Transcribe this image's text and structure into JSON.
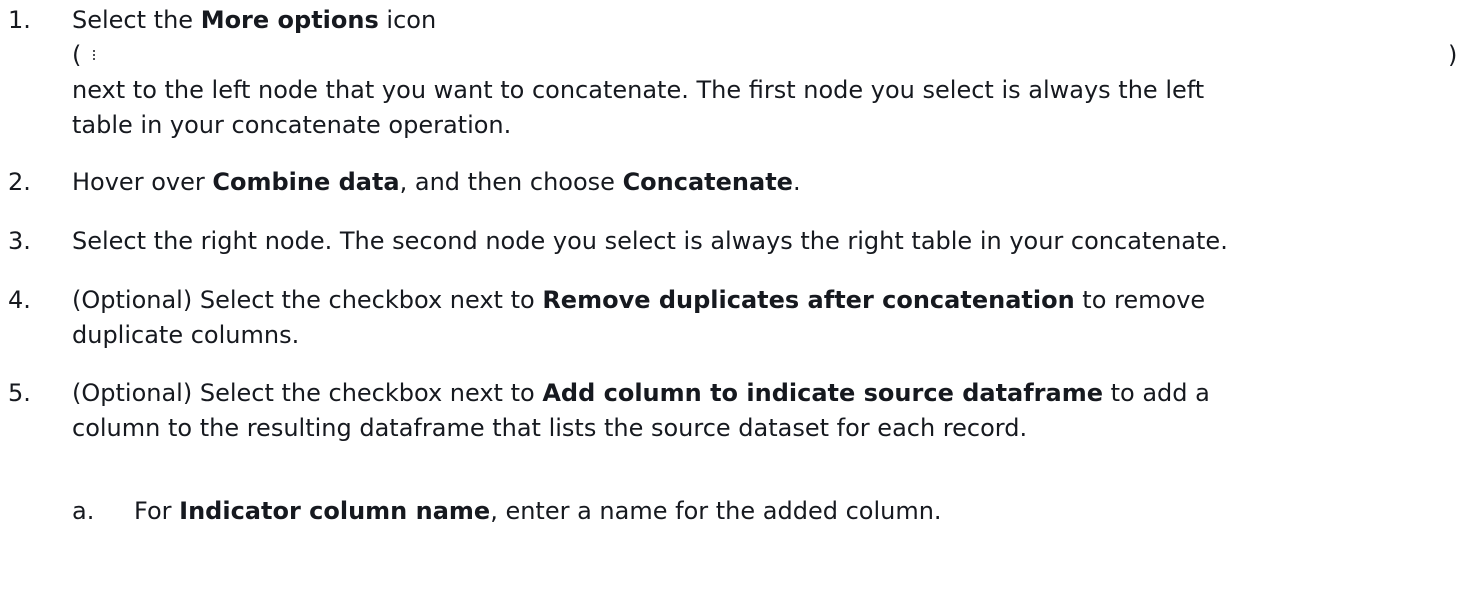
{
  "steps": [
    {
      "number": "1.",
      "pre": "Select the ",
      "bold": "More options",
      "post": " icon",
      "paren_open": "(",
      "paren_close": ")",
      "line3": "next to the left node that you want to concatenate. The first node you select is always the left",
      "line4": "table in your concatenate operation."
    },
    {
      "number": "2.",
      "pre": "Hover over ",
      "bold1": "Combine data",
      "mid": ", and then choose ",
      "bold2": "Concatenate",
      "post": "."
    },
    {
      "number": "3.",
      "text": "Select the right node. The second node you select is always the right table in your concatenate."
    },
    {
      "number": "4.",
      "pre": "(Optional) Select the checkbox next to ",
      "bold": "Remove duplicates after concatenation",
      "post": " to remove",
      "line2": "duplicate columns."
    },
    {
      "number": "5.",
      "pre": "(Optional) Select the checkbox next to ",
      "bold": "Add column to indicate source dataframe",
      "post": " to add a",
      "line2": "column to the resulting dataframe that lists the source dataset for each record."
    }
  ],
  "substep": {
    "letter": "a.",
    "pre": "For ",
    "bold": "Indicator column name",
    "post": ", enter a name for the added column."
  }
}
